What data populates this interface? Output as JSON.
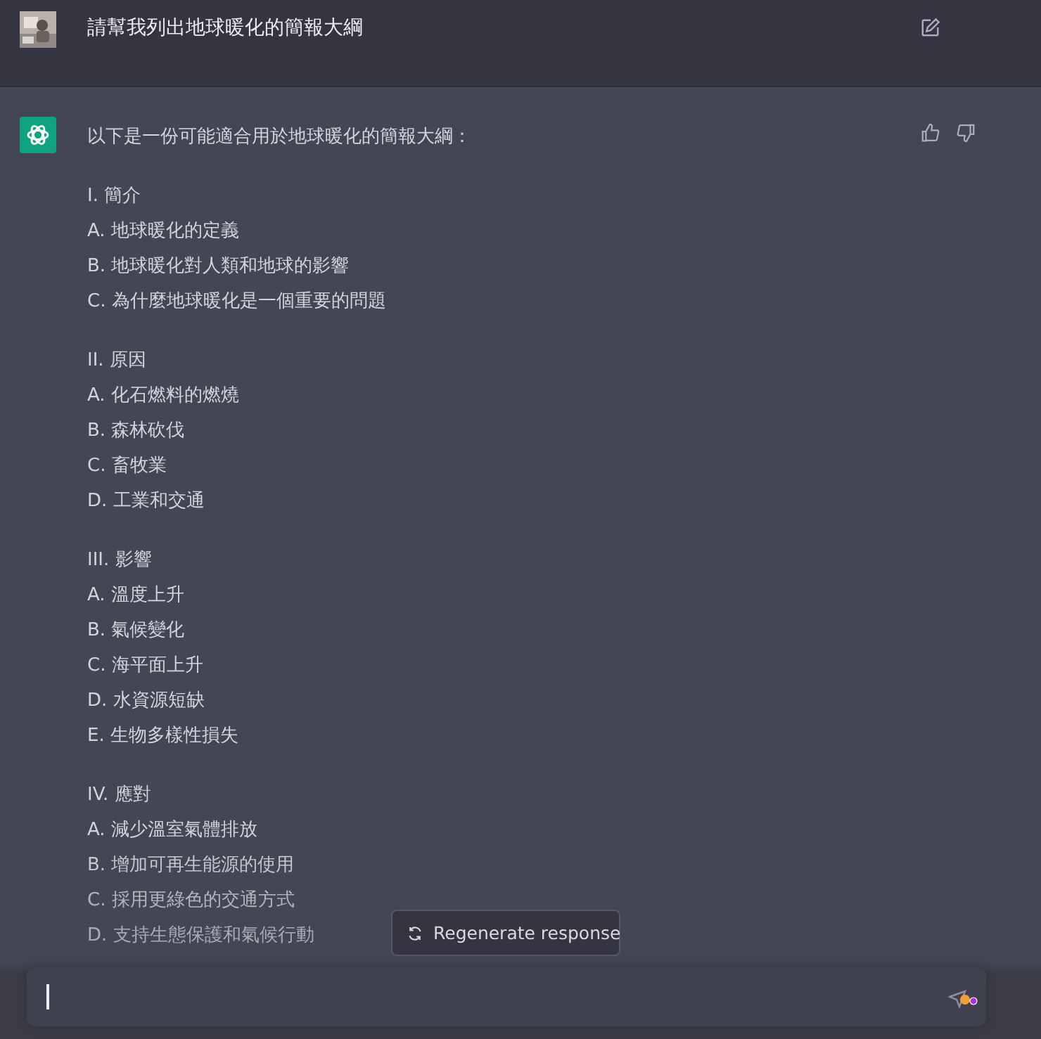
{
  "user_message": {
    "text": "請幫我列出地球暖化的簡報大綱"
  },
  "assistant_message": {
    "intro": "以下是一份可能適合用於地球暖化的簡報大綱：",
    "sections": [
      {
        "heading": "I. 簡介",
        "items": [
          "A. 地球暖化的定義",
          "B. 地球暖化對人類和地球的影響",
          "C. 為什麼地球暖化是一個重要的問題"
        ]
      },
      {
        "heading": "II. 原因",
        "items": [
          "A. 化石燃料的燃燒",
          "B. 森林砍伐",
          "C. 畜牧業",
          "D. 工業和交通"
        ]
      },
      {
        "heading": "III. 影響",
        "items": [
          "A. 溫度上升",
          "B. 氣候變化",
          "C. 海平面上升",
          "D. 水資源短缺",
          "E. 生物多樣性損失"
        ]
      },
      {
        "heading": "IV. 應對",
        "items": [
          "A. 減少溫室氣體排放",
          "B. 增加可再生能源的使用",
          "C. 採用更綠色的交通方式",
          "D. 支持生態保護和氣候行動"
        ]
      }
    ]
  },
  "regenerate_button": "Regenerate response"
}
